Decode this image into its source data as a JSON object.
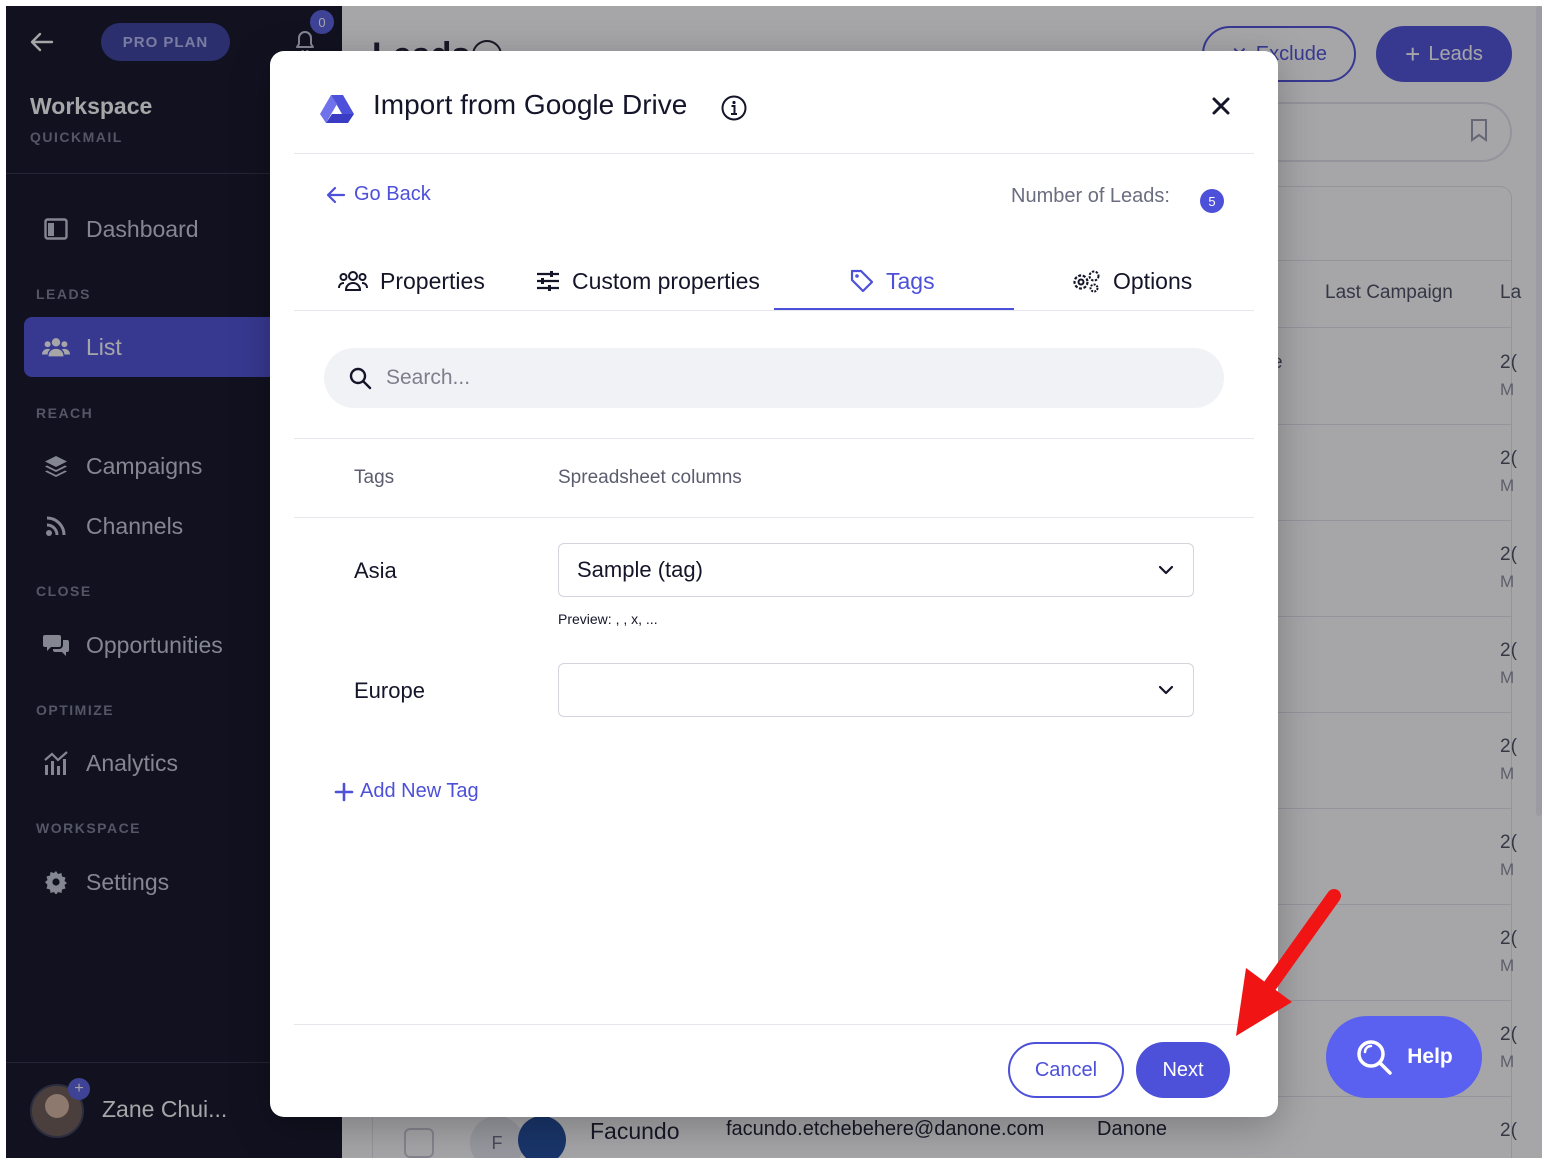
{
  "sidebar": {
    "plan_badge": "PRO PLAN",
    "notification_count": "0",
    "workspace_title": "Workspace",
    "workspace_subtitle": "QUICKMAIL",
    "sections": {
      "leads": "LEADS",
      "reach": "REACH",
      "close": "CLOSE",
      "optimize": "OPTIMIZE",
      "workspace": "WORKSPACE"
    },
    "items": {
      "dashboard": "Dashboard",
      "list": "List",
      "campaigns": "Campaigns",
      "channels": "Channels",
      "opportunities": "Opportunities",
      "analytics": "Analytics",
      "settings": "Settings"
    },
    "active_item": "List",
    "user_name": "Zane Chui...",
    "avatar_plus": "+"
  },
  "background": {
    "page_title": "Leads",
    "exclude_label": "Exclude",
    "add_leads_label": "Leads",
    "columns": {
      "last_campaign": "Last Campaign",
      "last_partial": "La"
    },
    "row_partials": [
      "2(",
      "M"
    ],
    "partial_char": "e",
    "visible_row": {
      "avatar_initial": "F",
      "first_name": "Facundo",
      "email": "facundo.etchebehere@danone.com",
      "company": "Danone"
    }
  },
  "modal": {
    "title": "Import from Google Drive",
    "go_back": "Go Back",
    "lead_count_label": "Number of Leads:",
    "lead_count": "5",
    "tabs": [
      {
        "label": "Properties",
        "icon": "users-icon"
      },
      {
        "label": "Custom properties",
        "icon": "sliders-icon"
      },
      {
        "label": "Tags",
        "icon": "tag-icon"
      },
      {
        "label": "Options",
        "icon": "gears-icon"
      }
    ],
    "active_tab": "Tags",
    "search_placeholder": "Search...",
    "table_headers": {
      "tags": "Tags",
      "columns": "Spreadsheet columns"
    },
    "rows": [
      {
        "tag": "Asia",
        "column": "Sample (tag)",
        "preview": "Preview: , , x, ..."
      },
      {
        "tag": "Europe",
        "column": ""
      }
    ],
    "add_new_tag": "Add New Tag",
    "cancel_label": "Cancel",
    "next_label": "Next"
  },
  "help_label": "Help",
  "colors": {
    "sidebar_bg": "#0f1022",
    "accent": "#4d50d9",
    "help_bg": "#5a60f0",
    "annotation_arrow": "#f01414"
  }
}
